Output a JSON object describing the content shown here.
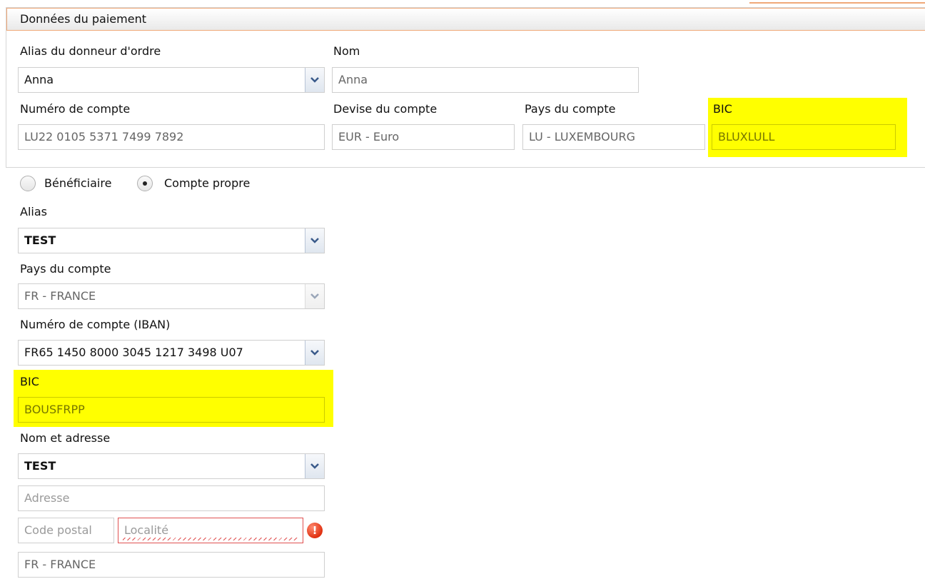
{
  "section": {
    "title": "Données du paiement"
  },
  "ordering": {
    "alias_label": "Alias du donneur d'ordre",
    "alias_value": "Anna",
    "name_label": "Nom",
    "name_value": "Anna",
    "account_label": "Numéro de compte",
    "account_value": "LU22 0105 5371 7499 7892",
    "currency_label": "Devise du compte",
    "currency_value": "EUR - Euro",
    "country_label": "Pays du compte",
    "country_value": "LU - LUXEMBOURG",
    "bic_label": "BIC",
    "bic_value": "BLUXLULL"
  },
  "beneficiary_type": {
    "options": [
      "Bénéficiaire",
      "Compte propre"
    ],
    "selected": "Compte propre"
  },
  "beneficiary": {
    "alias_label": "Alias",
    "alias_value": "TEST",
    "country_label": "Pays du compte",
    "country_value": "FR - FRANCE",
    "iban_label": "Numéro de compte (IBAN)",
    "iban_value": "FR65 1450 8000 3045 1217 3498 U07",
    "bic_label": "BIC",
    "bic_value": "BOUSFRPP",
    "name_address_label": "Nom et adresse",
    "name_value": "TEST",
    "address_placeholder": "Adresse",
    "postal_placeholder": "Code postal",
    "city_placeholder": "Localité",
    "address_country_value": "FR - FRANCE"
  },
  "icons": {
    "dropdown": "chevron-down-icon",
    "error": "exclamation-icon"
  },
  "colors": {
    "highlight": "#ffff00",
    "header_border": "#f0a878",
    "error": "#e03010"
  }
}
